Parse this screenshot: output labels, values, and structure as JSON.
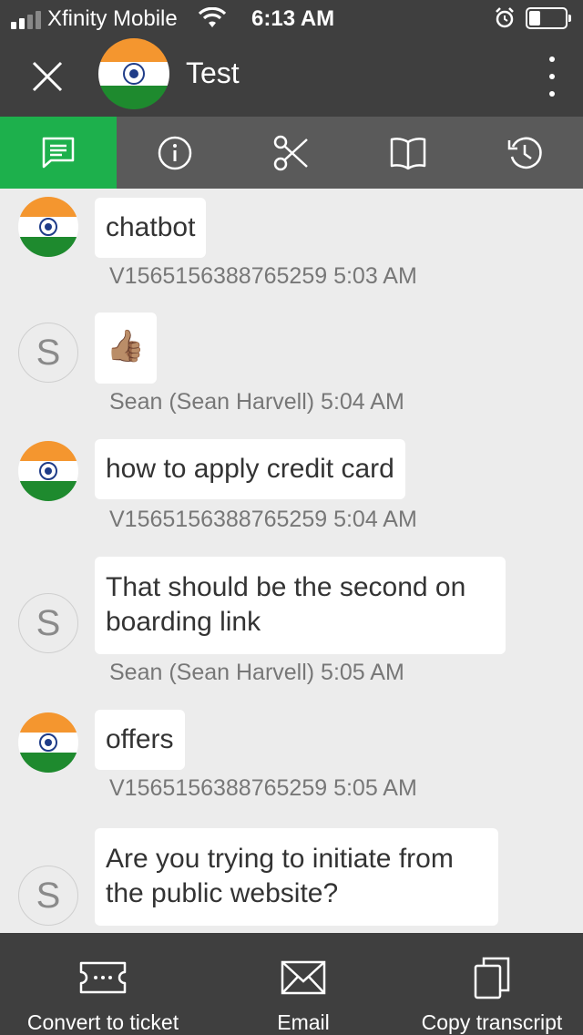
{
  "status_bar": {
    "carrier": "Xfinity Mobile",
    "time": "6:13 AM",
    "signal_bars": 4,
    "battery_level": 0.25
  },
  "header": {
    "title": "Test",
    "icons": [
      "close-icon",
      "flag-avatar",
      "more-vertical-icon"
    ]
  },
  "tabs": [
    {
      "icon": "chat-icon",
      "active": true
    },
    {
      "icon": "info-icon",
      "active": false
    },
    {
      "icon": "scissors-icon",
      "active": false
    },
    {
      "icon": "book-icon",
      "active": false
    },
    {
      "icon": "history-icon",
      "active": false
    }
  ],
  "messages": [
    {
      "avatar": "flag",
      "text": "chatbot",
      "meta": "V1565156388765259 5:03 AM"
    },
    {
      "avatar": "S",
      "text": "👍🏽",
      "meta": "Sean (Sean Harvell) 5:04 AM"
    },
    {
      "avatar": "flag",
      "text": "how to apply credit card",
      "meta": "V1565156388765259 5:04 AM"
    },
    {
      "avatar": "S",
      "text": "That should be the second on boarding link",
      "meta": "Sean (Sean Harvell) 5:05 AM"
    },
    {
      "avatar": "flag",
      "text": "offers",
      "meta": "V1565156388765259 5:05 AM"
    },
    {
      "avatar": "S",
      "text": "Are you trying to initiate from the public website?",
      "meta": ""
    }
  ],
  "bottom_actions": [
    {
      "label": "Convert to ticket",
      "icon": "ticket-icon"
    },
    {
      "label": "Email",
      "icon": "envelope-icon"
    },
    {
      "label": "Copy transcript",
      "icon": "copy-icon"
    }
  ],
  "colors": {
    "bar_bg": "#3f3f3f",
    "tab_bg": "#5a5a5a",
    "tab_active": "#1db04c",
    "chat_bg": "#ececec"
  }
}
